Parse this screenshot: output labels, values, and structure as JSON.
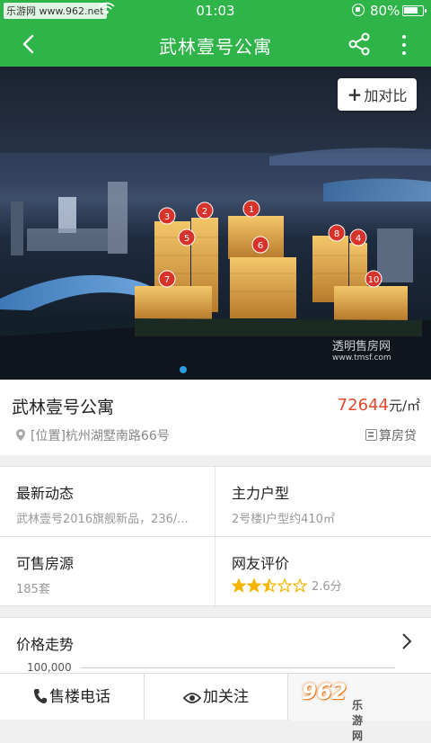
{
  "status_bar": {
    "watermark": "乐游网 www.962.net",
    "time": "01:03",
    "battery": "80%",
    "battery_level": 0.8
  },
  "nav": {
    "title": "武林壹号公寓",
    "icons": [
      "back-arrow-icon",
      "share-icon",
      "more-vertical-icon"
    ]
  },
  "hero": {
    "compare_label": "加对比",
    "building_markers": [
      "1",
      "2",
      "3",
      "4",
      "5",
      "6",
      "7",
      "8",
      "10"
    ],
    "watermark_title": "透明售房网",
    "watermark_url": "www.tmsf.com",
    "page_indicator_active": 1
  },
  "property": {
    "name": "武林壹号公寓",
    "price": "72644",
    "price_unit": "元/㎡",
    "address": "[位置]杭州湖墅南路66号",
    "calc_label": "算房贷"
  },
  "info_grid": {
    "latest_news_title": "最新动态",
    "latest_news_value": "武林壹号2016旗舰新品，236/...",
    "main_unit_title": "主力户型",
    "main_unit_value": "2号楼I户型约410㎡",
    "available_title": "可售房源",
    "available_value": "185套",
    "rating_title": "网友评价",
    "rating_value": "2.6分",
    "rating_stars": 2.5,
    "rating_max": 5
  },
  "trend": {
    "title": "价格走势",
    "y_tick": "100,000"
  },
  "bottom_bar": {
    "call_label": "售楼电话",
    "follow_label": "加关注",
    "logo_text": "962",
    "logo_site": "乐游网"
  },
  "colors": {
    "brand_green": "#2eb449",
    "price_red": "#e0492b",
    "star_gold": "#f5b400"
  }
}
